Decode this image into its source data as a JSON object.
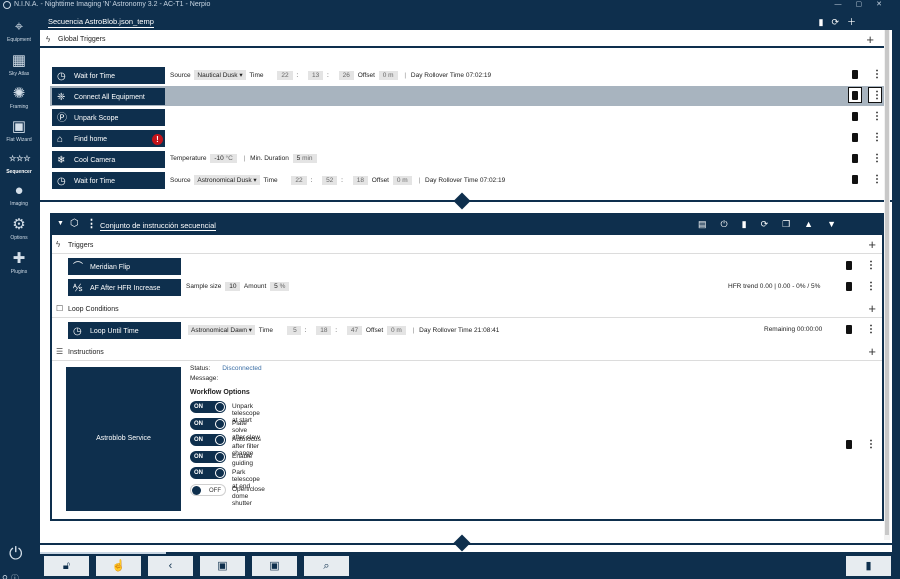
{
  "app": {
    "title": "N.I.N.A. - Nighttime Imaging 'N' Astronomy 3.2  -  AC-T1 - Nerpio"
  },
  "colors": {
    "primary": "#0e2f4d",
    "highlight": "#a8b4bf",
    "warning": "#c4131a",
    "link": "#3a6ea5"
  },
  "sidebar": {
    "items": [
      {
        "label": "Equipment",
        "icon": "telescope-icon"
      },
      {
        "label": "Sky Atlas",
        "icon": "map-icon"
      },
      {
        "label": "Framing",
        "icon": "framing-icon"
      },
      {
        "label": "Flat Wizard",
        "icon": "flat-wizard-icon"
      },
      {
        "label": "Sequencer",
        "icon": "sequencer-icon",
        "active": true
      },
      {
        "label": "Imaging",
        "icon": "imaging-icon"
      },
      {
        "label": "Options",
        "icon": "gears-icon"
      },
      {
        "label": "Plugins",
        "icon": "puzzle-icon"
      }
    ]
  },
  "tab": {
    "label": "Secuencia AstroBlob.json_temp"
  },
  "global_triggers": {
    "label": "Global Triggers"
  },
  "rows": [
    {
      "label": "Wait for Time",
      "icon": "clock-icon",
      "source_label": "Source",
      "source": "Nautical Dusk",
      "time_label": "Time",
      "h": "22",
      "m": "13",
      "s": "26",
      "offset_label": "Offset",
      "offset": "0",
      "offset_unit": "m",
      "rollover": "Day Rollover Time 07:02:19"
    },
    {
      "label": "Connect All Equipment",
      "icon": "plug-icon"
    },
    {
      "label": "Unpark Scope",
      "icon": "unpark-icon"
    },
    {
      "label": "Find home",
      "icon": "home-icon",
      "warning": "!"
    },
    {
      "label": "Cool Camera",
      "icon": "snowflake-icon",
      "temp_label": "Temperature",
      "temp": "-10",
      "temp_unit": "°C",
      "duration_label": "Min. Duration",
      "duration": "5",
      "duration_unit": "min"
    },
    {
      "label": "Wait for Time",
      "icon": "clock-icon",
      "source_label": "Source",
      "source": "Astronomical Dusk",
      "time_label": "Time",
      "h": "22",
      "m": "52",
      "s": "18",
      "offset_label": "Offset",
      "offset": "0",
      "offset_unit": "m",
      "rollover": "Day Rollover Time 07:02:19"
    }
  ],
  "container": {
    "title": "Conjunto de instrucción secuencial",
    "triggers_label": "Triggers",
    "meridian_flip": {
      "label": "Meridian Flip"
    },
    "af_after_hfr": {
      "label": "AF After HFR Increase",
      "sample_label": "Sample size",
      "sample": "10",
      "amount_label": "Amount",
      "amount": "5",
      "amount_unit": "%",
      "hfr_trend": "HFR trend 0.00 | 0.00 - 0% / 5%"
    },
    "loop_conditions_label": "Loop Conditions",
    "loop_until": {
      "label": "Loop Until Time",
      "source": "Astronomical Dawn",
      "time_label": "Time",
      "h": "5",
      "m": "18",
      "s": "47",
      "offset_label": "Offset",
      "offset": "0",
      "offset_unit": "m",
      "rollover": "Day Rollover Time 21:08:41",
      "remaining": "Remaining 00:00:00"
    },
    "instructions_label": "Instructions",
    "service": {
      "label": "Astroblob Service",
      "status_label": "Status:",
      "status": "Disconnected",
      "message_label": "Message:",
      "workflow_title": "Workflow Options",
      "options": [
        {
          "state": "ON",
          "label": "Unpark telescope at start"
        },
        {
          "state": "ON",
          "label": "Plate solve after slew"
        },
        {
          "state": "ON",
          "label": "Autofocus after filter change"
        },
        {
          "state": "ON",
          "label": "Enable guiding"
        },
        {
          "state": "ON",
          "label": "Park telescope at end"
        },
        {
          "state": "OFF",
          "label": "Open/close dome shutter"
        }
      ]
    }
  }
}
